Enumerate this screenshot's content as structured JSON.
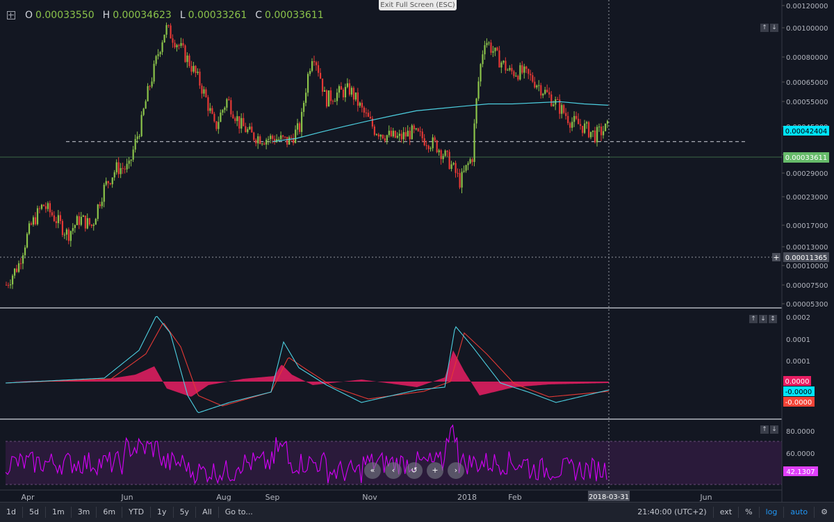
{
  "ohlc": {
    "o_label": "O",
    "o_value": "0.00033550",
    "h_label": "H",
    "h_value": "0.00034623",
    "l_label": "L",
    "l_value": "0.00033261",
    "c_label": "C",
    "c_value": "0.00033611"
  },
  "exit_fullscreen": "Exit Full Screen (ESC)",
  "price_axis": {
    "ticks": [
      "0.00120000",
      "0.00100000",
      "0.00080000",
      "0.00065000",
      "0.00055000",
      "0.00045000",
      "0.00035000",
      "0.00029000",
      "0.00023000",
      "0.00017000",
      "0.00013000",
      "0.00010000",
      "0.00007500",
      "0.00005300"
    ],
    "badge_ma": "0.00042404",
    "badge_last": "0.00033611",
    "badge_cursor": "0.00011365"
  },
  "macd_axis": {
    "ticks": [
      "0.0002",
      "0.0001",
      "0.0001"
    ],
    "badge_hist": "0.0000",
    "badge_macd": "-0.0000",
    "badge_signal": "-0.0000"
  },
  "rsi_axis": {
    "ticks": [
      "80.0000",
      "60.0000"
    ],
    "badge_rsi": "42.1307"
  },
  "time_axis": {
    "labels": [
      "Apr",
      "Jun",
      "Aug",
      "Sep",
      "Nov",
      "2018",
      "Feb",
      "Jun"
    ],
    "cursor_date": "2018-03-31"
  },
  "bottom_bar": {
    "timeframes": [
      "1d",
      "5d",
      "1m",
      "3m",
      "6m",
      "YTD",
      "1y",
      "5y",
      "All",
      "Go to..."
    ],
    "time": "21:40:00 (UTC+2)",
    "ext": "ext",
    "pct": "%",
    "log": "log",
    "auto": "auto"
  },
  "icons": {
    "settings": "gear-icon",
    "crosshair": "crosshair-icon",
    "replay": [
      "rewind-icon",
      "step-back-icon",
      "reset-icon",
      "plus-icon",
      "forward-icon"
    ]
  },
  "colors": {
    "background": "#131722",
    "up_candle": "#8bc34a",
    "down_candle": "#e53935",
    "ma": "#4dd0e1",
    "macd": "#4dd0e1",
    "signal": "#e53935",
    "histogram": "#e91e63",
    "rsi": "#d500f9",
    "rsi_band": "#3b1f4d"
  },
  "chart_data": {
    "type": "candlestick",
    "price_scale": "log",
    "ylim": [
      5.3e-05,
      0.0012
    ],
    "horizontal_level": 0.00029,
    "months": [
      "Apr",
      "Jun",
      "Aug",
      "Sep",
      "Nov",
      "2018",
      "Feb",
      "Jun"
    ],
    "close_path": [
      6.5e-05,
      8e-05,
      0.00012,
      0.00015,
      0.00013,
      0.00011,
      0.00013,
      0.00012,
      0.00018,
      0.00022,
      0.00022,
      0.00035,
      0.0006,
      0.00095,
      0.0008,
      0.00065,
      0.0005,
      0.00033,
      0.00045,
      0.00035,
      0.00031,
      0.0003,
      0.0003,
      0.00029,
      0.00034,
      0.00075,
      0.00045,
      0.00048,
      0.0005,
      0.0004,
      0.00033,
      0.00031,
      0.0003,
      0.00032,
      0.0003,
      0.00028,
      0.00024,
      0.00019,
      0.00025,
      0.00085,
      0.0007,
      0.0006,
      0.0006,
      0.00055,
      0.00048,
      0.00042,
      0.00036,
      0.00034,
      0.00031,
      0.000336
    ],
    "ma_path": [
      0.00029,
      0.0003,
      0.00032,
      0.00034,
      0.00036,
      0.00038,
      0.0004,
      0.00041,
      0.00042,
      0.00043,
      0.00043,
      0.000435,
      0.00044,
      0.00043,
      0.00042404
    ],
    "macd_hist_peaks": [
      0.0,
      0.6,
      -0.6,
      0.5,
      -0.4,
      1.0,
      -0.5,
      0.0
    ],
    "rsi_range": [
      30,
      88
    ],
    "rsi_bands": [
      30,
      70
    ]
  }
}
